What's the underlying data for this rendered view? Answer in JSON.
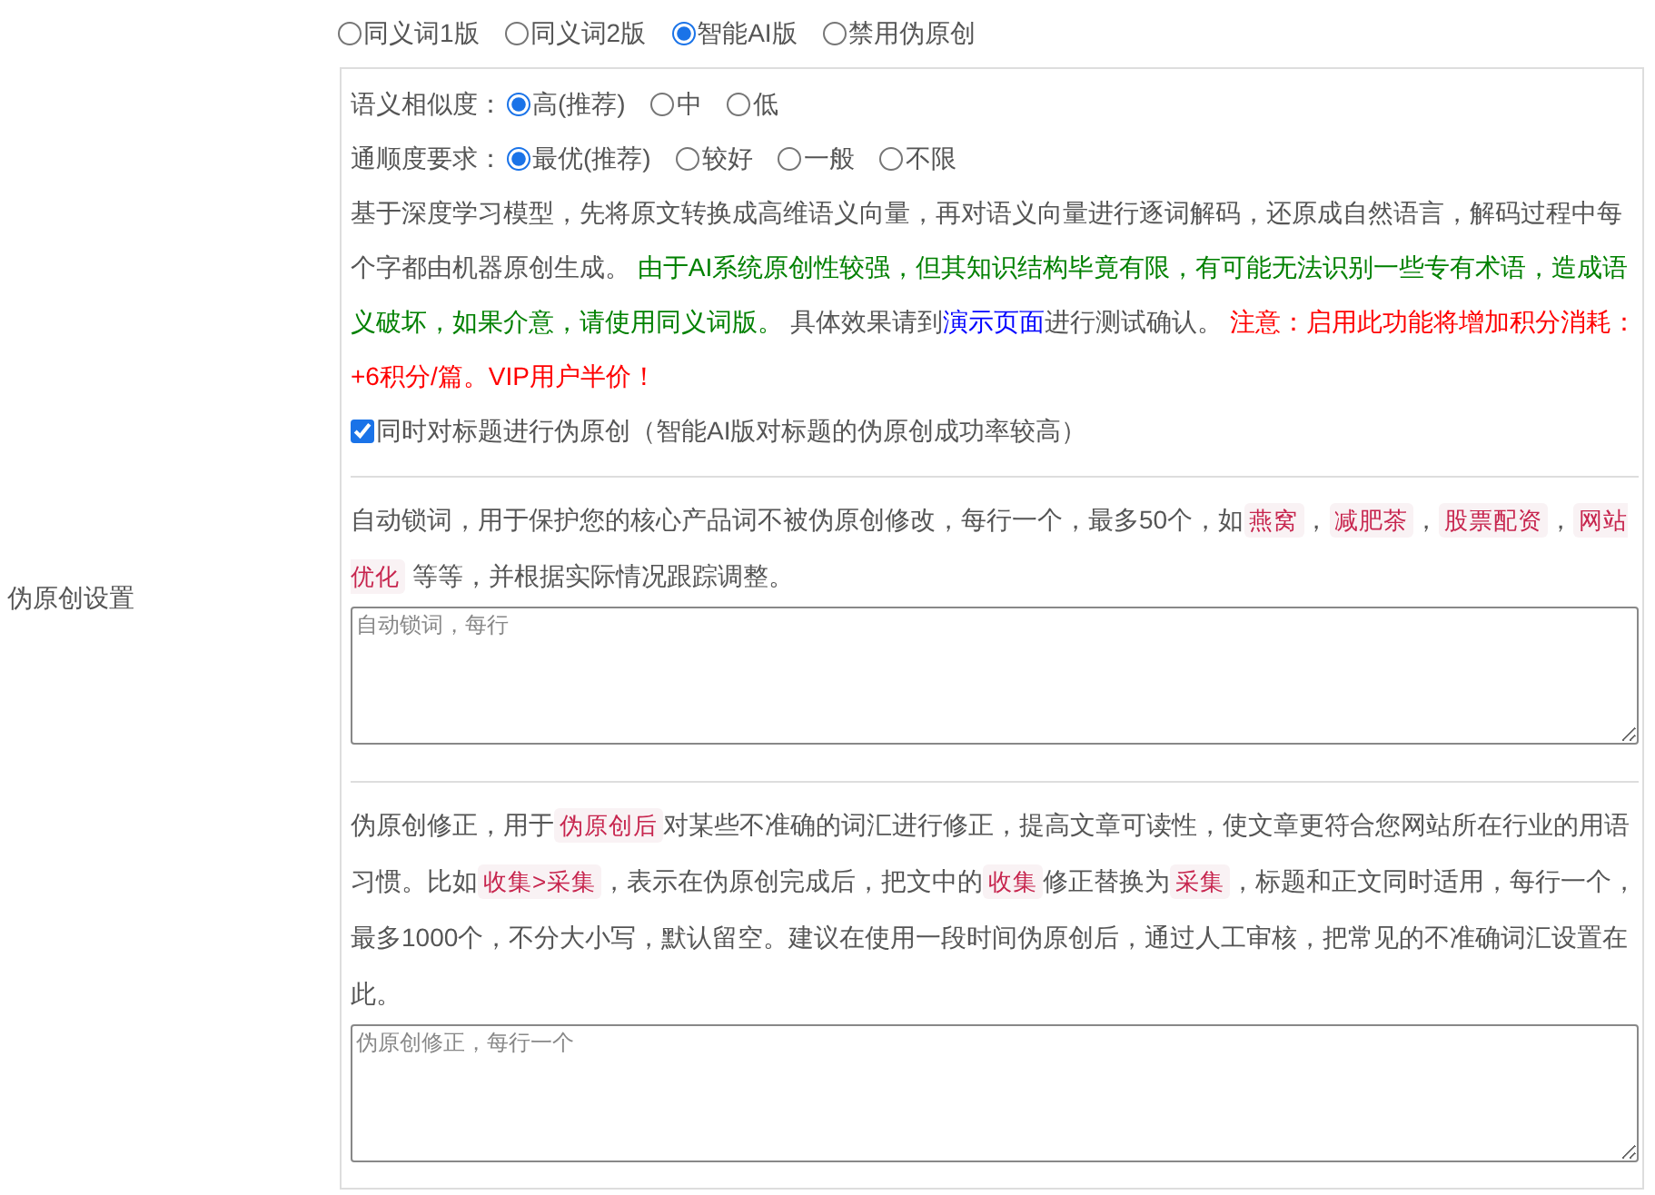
{
  "section_label": "伪原创设置",
  "modes": [
    {
      "label": "同义词1版",
      "selected": false
    },
    {
      "label": "同义词2版",
      "selected": false
    },
    {
      "label": "智能AI版",
      "selected": true
    },
    {
      "label": "禁用伪原创",
      "selected": false
    }
  ],
  "similarity": {
    "label": "语义相似度：",
    "options": [
      {
        "label": "高(推荐)",
        "selected": true
      },
      {
        "label": "中",
        "selected": false
      },
      {
        "label": "低",
        "selected": false
      }
    ]
  },
  "fluency": {
    "label": "通顺度要求：",
    "options": [
      {
        "label": "最优(推荐)",
        "selected": true
      },
      {
        "label": "较好",
        "selected": false
      },
      {
        "label": "一般",
        "selected": false
      },
      {
        "label": "不限",
        "selected": false
      }
    ]
  },
  "description": [
    {
      "kind": "plain",
      "text": "基于深度学习模型，先将原文转换成高维语义向量，再对语义向量进行逐词解码，还原成自然语言，解码过程中每个字都由机器原创生成。 "
    },
    {
      "kind": "note",
      "text": "由于AI系统原创性较强，但其知识结构毕竟有限，有可能无法识别一些专有术语，造成语义破坏，如果介意，请使用同义词版。"
    },
    {
      "kind": "plain",
      "text": " 具体效果请到"
    },
    {
      "kind": "link",
      "text": "演示页面"
    },
    {
      "kind": "plain",
      "text": "进行测试确认。 "
    },
    {
      "kind": "warning",
      "text": "注意：启用此功能将增加积分消耗：+6积分/篇。VIP用户半价！"
    }
  ],
  "title_option": {
    "label": "同时对标题进行伪原创（智能AI版对标题的伪原创成功率较高）",
    "checked": true
  },
  "lock_words": {
    "description": [
      {
        "kind": "plain",
        "text": "自动锁词，用于保护您的核心产品词不被伪原创修改，每行一个，最多50个，如"
      },
      {
        "kind": "tag",
        "text": "燕窝"
      },
      {
        "kind": "plain",
        "text": "，"
      },
      {
        "kind": "tag",
        "text": "减肥茶"
      },
      {
        "kind": "plain",
        "text": "，"
      },
      {
        "kind": "tag",
        "text": "股票配资"
      },
      {
        "kind": "plain",
        "text": "，"
      },
      {
        "kind": "tag",
        "text": "网站优化"
      },
      {
        "kind": "plain",
        "text": " 等等，并根据实际情况跟踪调整。"
      }
    ],
    "placeholder": "自动锁词，每行"
  },
  "corrections": {
    "description": [
      {
        "kind": "plain",
        "text": "伪原创修正，用于"
      },
      {
        "kind": "tag",
        "text": "伪原创后"
      },
      {
        "kind": "plain",
        "text": "对某些不准确的词汇进行修正，提高文章可读性，使文章更符合您网站所在行业的用语习惯。比如"
      },
      {
        "kind": "tag",
        "text": "收集>采集"
      },
      {
        "kind": "plain",
        "text": "，表示在伪原创完成后，把文中的"
      },
      {
        "kind": "tag",
        "text": "收集"
      },
      {
        "kind": "plain",
        "text": "修正替换为"
      },
      {
        "kind": "tag",
        "text": "采集"
      },
      {
        "kind": "plain",
        "text": "，标题和正文同时适用，每行一个，最多1000个，不分大小写，默认留空。建议在使用一段时间伪原创后，通过人工审核，把常见的不准确词汇设置在此。"
      }
    ],
    "placeholder": "伪原创修正，每行一个"
  }
}
